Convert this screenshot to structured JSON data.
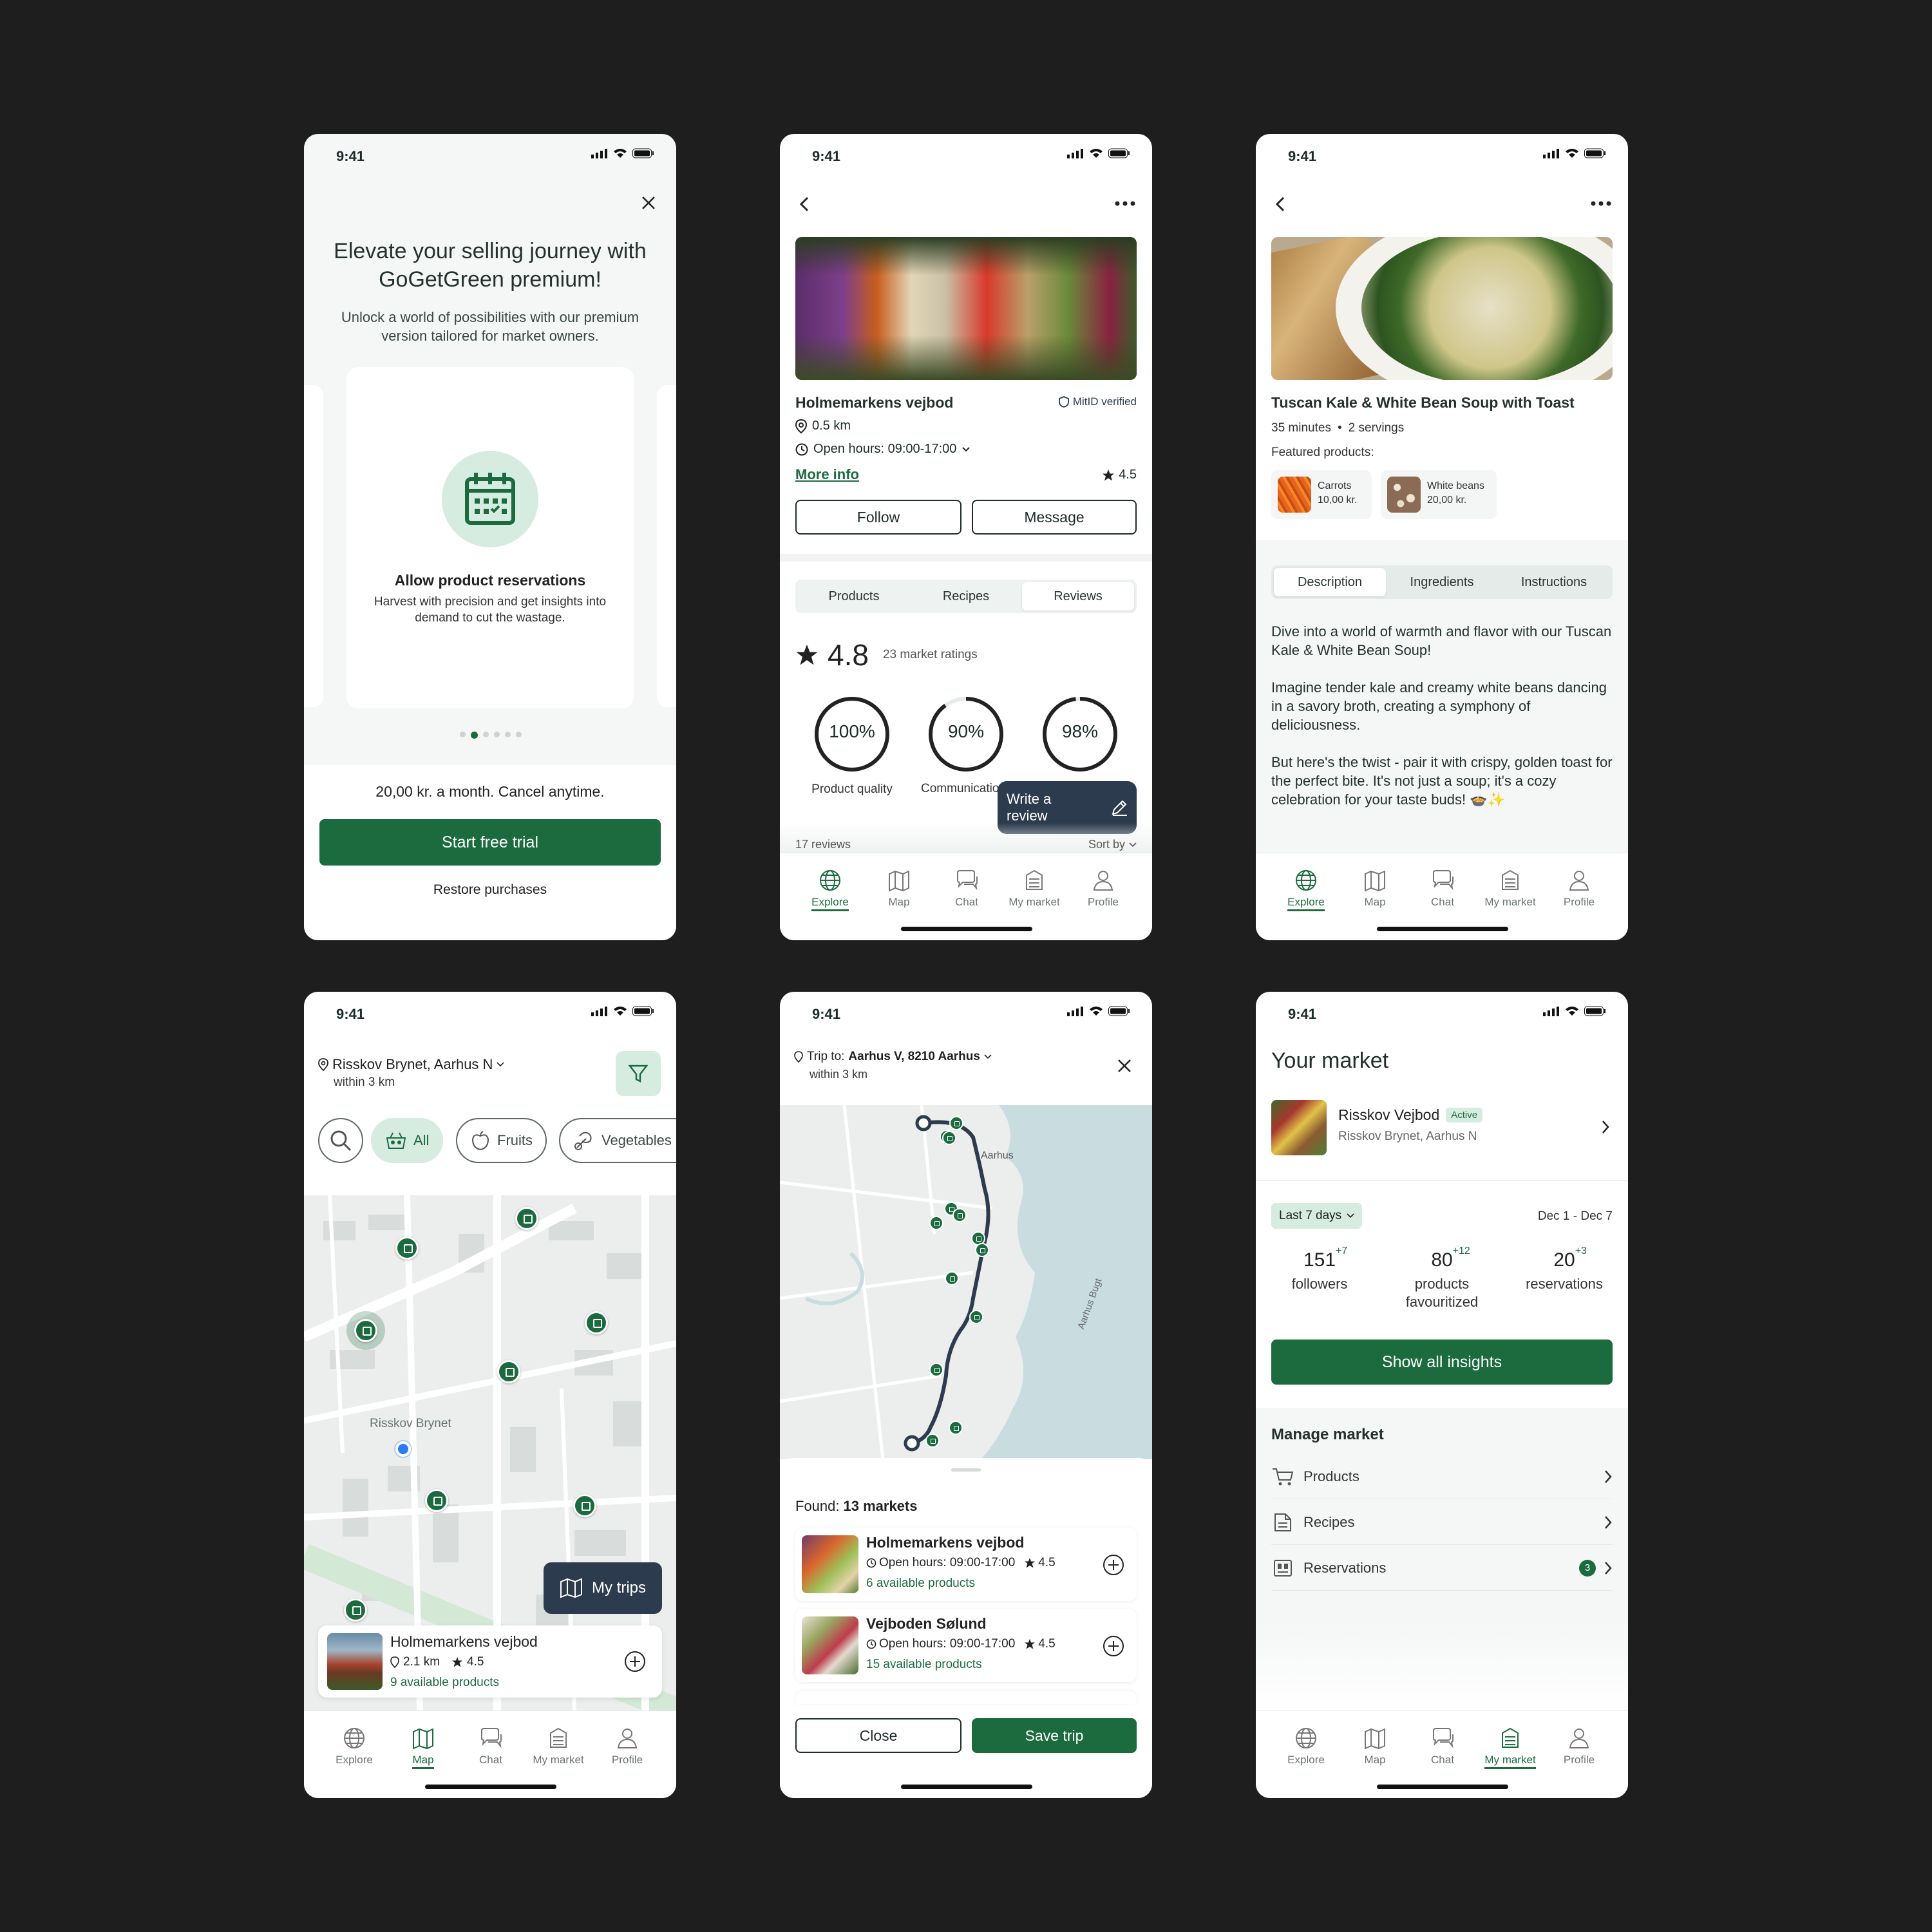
{
  "status_time": "9:41",
  "colors": {
    "brand_green": "#1b6b3f",
    "dark_navy": "#2d3b4e",
    "light_green": "#d6ece0"
  },
  "screen1": {
    "title": "Elevate your selling journey with GoGetGreen premium!",
    "subtitle": "Unlock a world of possibilities with our premium version tailored for market owners.",
    "card_title": "Allow product reservations",
    "card_desc": "Harvest with precision and get insights into demand to cut the wastage.",
    "card_icon": "calendar-icon",
    "price": "20,00 kr. a month. Cancel anytime.",
    "cta": "Start free trial",
    "restore": "Restore purchases"
  },
  "screen2": {
    "market_name": "Holmemarkens vejbod",
    "verified": "MitID verified",
    "distance": "0.5 km",
    "hours": "Open hours: 09:00-17:00",
    "more_info": "More info",
    "rating_small": "4.5",
    "follow": "Follow",
    "message": "Message",
    "tabs": [
      "Products",
      "Recipes",
      "Reviews"
    ],
    "rating_big": "4.8",
    "ratings_count": "23 market ratings",
    "rings": [
      {
        "pct": "100%",
        "label": "Product quality",
        "value": 1.0
      },
      {
        "pct": "90%",
        "label": "Communication",
        "value": 0.9
      },
      {
        "pct": "98%",
        "label": "",
        "value": 0.98
      }
    ],
    "write_review": "Write a review",
    "reviews_count": "17 reviews",
    "sort_by": "Sort by"
  },
  "screen3": {
    "title": "Tuscan Kale & White Bean Soup with Toast",
    "minutes": "35 minutes",
    "servings": "2 servings",
    "featured_label": "Featured products:",
    "products": [
      {
        "name": "Carrots",
        "price": "10,00 kr."
      },
      {
        "name": "White beans",
        "price": "20,00 kr."
      }
    ],
    "tabs": [
      "Description",
      "Ingredients",
      "Instructions"
    ],
    "para1": "Dive into a world of warmth and flavor with our Tuscan Kale & White Bean Soup!",
    "para2": "Imagine tender kale and creamy white beans dancing in a savory broth, creating a symphony of deliciousness.",
    "para3": "But here's the twist - pair it with crispy, golden toast for the perfect bite. It's not just a soup; it's a cozy celebration for your taste buds! 🍲✨"
  },
  "screen4": {
    "location": "Risskov Brynet, Aarhus N",
    "radius": "within 3 km",
    "chips": [
      "All",
      "Fruits",
      "Vegetables"
    ],
    "map_label": "Risskov Brynet",
    "my_trips": "My trips",
    "card_name": "Holmemarkens vejbod",
    "card_distance": "2.1 km",
    "card_rating": "4.5",
    "card_products": "9 available products"
  },
  "screen5": {
    "trip_prefix": "Trip to:",
    "trip_dest": "Aarhus V, 8210 Aarhus",
    "radius": "within 3 km",
    "map_city": "Aarhus",
    "map_bay": "Aarhus Bugt",
    "found_prefix": "Found:",
    "found_count": "13 markets",
    "markets": [
      {
        "name": "Holmemarkens vejbod",
        "hours": "Open hours: 09:00-17:00",
        "rating": "4.5",
        "products": "6 available products"
      },
      {
        "name": "Vejboden Sølund",
        "hours": "Open hours: 09:00-17:00",
        "rating": "4.5",
        "products": "15 available products"
      }
    ],
    "close": "Close",
    "save": "Save trip"
  },
  "screen6": {
    "title": "Your market",
    "market_name": "Risskov Vejbod",
    "badge": "Active",
    "market_loc": "Risskov Brynet, Aarhus N",
    "period": "Last 7 days",
    "date_range": "Dec 1 - Dec 7",
    "stats": [
      {
        "value": "151",
        "delta": "+7",
        "label": "followers"
      },
      {
        "value": "80",
        "delta": "+12",
        "label": "products favouritized"
      },
      {
        "value": "20",
        "delta": "+3",
        "label": "reservations"
      }
    ],
    "insights": "Show all insights",
    "manage_title": "Manage market",
    "manage_items": [
      "Products",
      "Recipes",
      "Reservations"
    ],
    "reservations_badge": "3"
  },
  "tabbar": [
    "Explore",
    "Map",
    "Chat",
    "My market",
    "Profile"
  ]
}
